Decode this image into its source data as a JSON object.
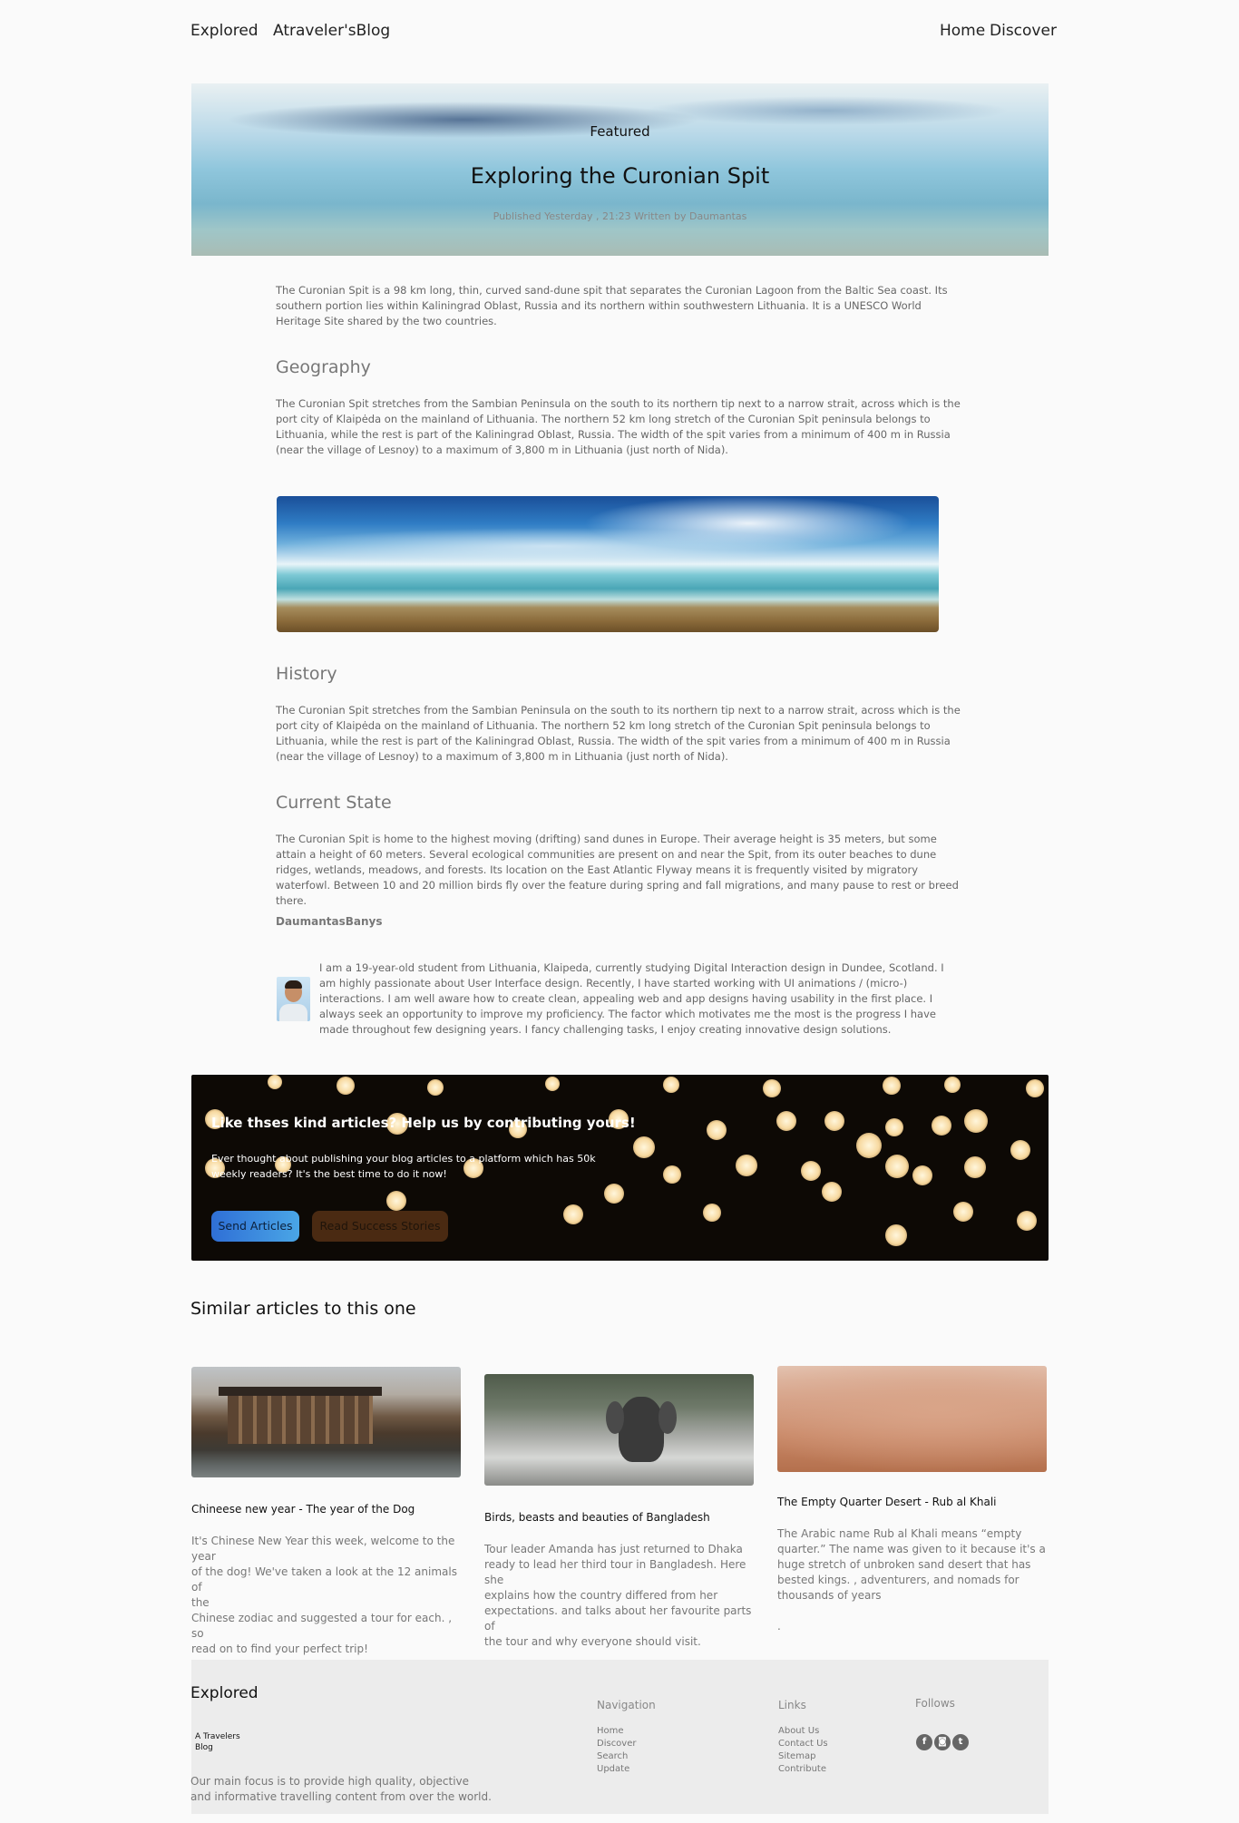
{
  "nav": {
    "brand": "Explored",
    "blog_name": "Atraveler'sBlog",
    "links": [
      "Home",
      "Discover"
    ]
  },
  "hero": {
    "label": "Featured",
    "title": "Exploring the Curonian Spit",
    "meta": "Published Yesterday , 21:23 Written by Daumantas"
  },
  "article": {
    "intro": "The Curonian Spit is a 98 km long, thin, curved sand-dune spit that separates the Curonian Lagoon from the Baltic Sea coast. Its southern portion lies within Kaliningrad Oblast, Russia and its northern within southwestern Lithuania. It is a UNESCO World Heritage Site shared by the two countries.",
    "sections": [
      {
        "heading": "Geography",
        "text": "The Curonian Spit stretches from the Sambian Peninsula on the south to its northern tip next to a narrow strait, across which is the port city of Klaipėda on the mainland of Lithuania. The northern 52 km long stretch of the Curonian Spit peninsula belongs to Lithuania, while the rest is part of the Kaliningrad Oblast, Russia. The width of the spit varies from a minimum of 400 m in Russia (near the village of Lesnoy) to a maximum of 3,800 m in Lithuania (just north of Nida)."
      },
      {
        "heading": "History",
        "text": "The Curonian Spit stretches from the Sambian Peninsula on the south to its northern tip next to a narrow strait, across which is the port city of Klaipėda on the mainland of Lithuania. The northern 52 km long stretch of the Curonian Spit peninsula belongs to Lithuania, while the rest is part of the Kaliningrad Oblast, Russia. The width of the spit varies from a minimum of 400 m in Russia (near the village of Lesnoy) to a maximum of 3,800 m in Lithuania (just north of Nida)."
      },
      {
        "heading": "Current State",
        "text": "The Curonian Spit is home to the highest moving (drifting) sand dunes in Europe. Their average height is 35 meters, but some attain a height of 60 meters. Several ecological communities are present on and near the Spit, from its outer beaches to dune ridges, wetlands, meadows, and forests. Its location on the East Atlantic Flyway means it is frequently visited by migratory waterfowl. Between 10 and 20 million birds fly over the feature during spring and fall migrations, and many pause to rest or breed there."
      }
    ],
    "author": {
      "name": "DaumantasBanys",
      "bio": "I am a 19-year-old student from Lithuania, Klaipeda, currently studying Digital Interaction design in Dundee, Scotland. I am highly passionate about User Interface design. Recently, I have started working with UI animations / (micro-) interactions. I am well aware how to create clean, appealing web and app designs having usability in the first place. I always seek an opportunity to improve my proficiency. The factor which motivates me the most is the progress I have made throughout few designing years. I fancy challenging tasks, I enjoy creating innovative design solutions."
    }
  },
  "cta": {
    "title": "Like thses kind articles? Help us by contributing yours!",
    "text": "Ever thought about publishing your blog articles to a platform which has 50k weekly readers? It's the best time to do it now!",
    "primary_button": "Send Articles",
    "secondary_button": "Read Success Stories"
  },
  "similar": {
    "title": "Similar articles to this one",
    "cards": [
      {
        "title": "Chineese new year - The year of the Dog",
        "text_lines": [
          "It's Chinese New Year this week, welcome to the year",
          "of the dog! We've taken a look at the 12 animals of",
          "the",
          "Chinese zodiac and suggested a tour for each. , so",
          "read on to find your perfect trip!"
        ]
      },
      {
        "title": "Birds, beasts and beauties of Bangladesh",
        "text_lines": [
          "Tour leader Amanda has just returned to Dhaka",
          "ready to lead her third tour in Bangladesh. Here she",
          "explains how the country differed from her",
          "expectations. and talks about her favourite parts of",
          "the tour and why everyone should visit."
        ]
      },
      {
        "title": "The Empty Quarter Desert - Rub al Khali",
        "text_lines": [
          "The Arabic name Rub al Khali means “empty",
          "quarter.” The name was given to it because it's a",
          "huge stretch of unbroken sand desert that has",
          "bested kings. , adventurers, and nomads for",
          "thousands of years",
          "",
          "."
        ]
      }
    ]
  },
  "footer": {
    "brand": "Explored",
    "tagline_line1": "A Travelers",
    "tagline_line2": "Blog",
    "description_line1": "Our main focus is to provide high quality, objective",
    "description_line2": "and informative travelling content from over the world.",
    "navigation_title": "Navigation",
    "navigation_links": [
      "Home",
      "Discover",
      "Search",
      "Update"
    ],
    "links_title": "Links",
    "links": [
      "About Us",
      "Contact Us",
      "Sitemap",
      "Contribute"
    ],
    "follows_title": "Follows",
    "social_icons": [
      "facebook-icon",
      "instagram-icon",
      "twitter-icon"
    ]
  },
  "colors": {
    "primary_button": "#3b82e0",
    "secondary_button": "#5a3216",
    "footer_bg": "#ececec"
  }
}
